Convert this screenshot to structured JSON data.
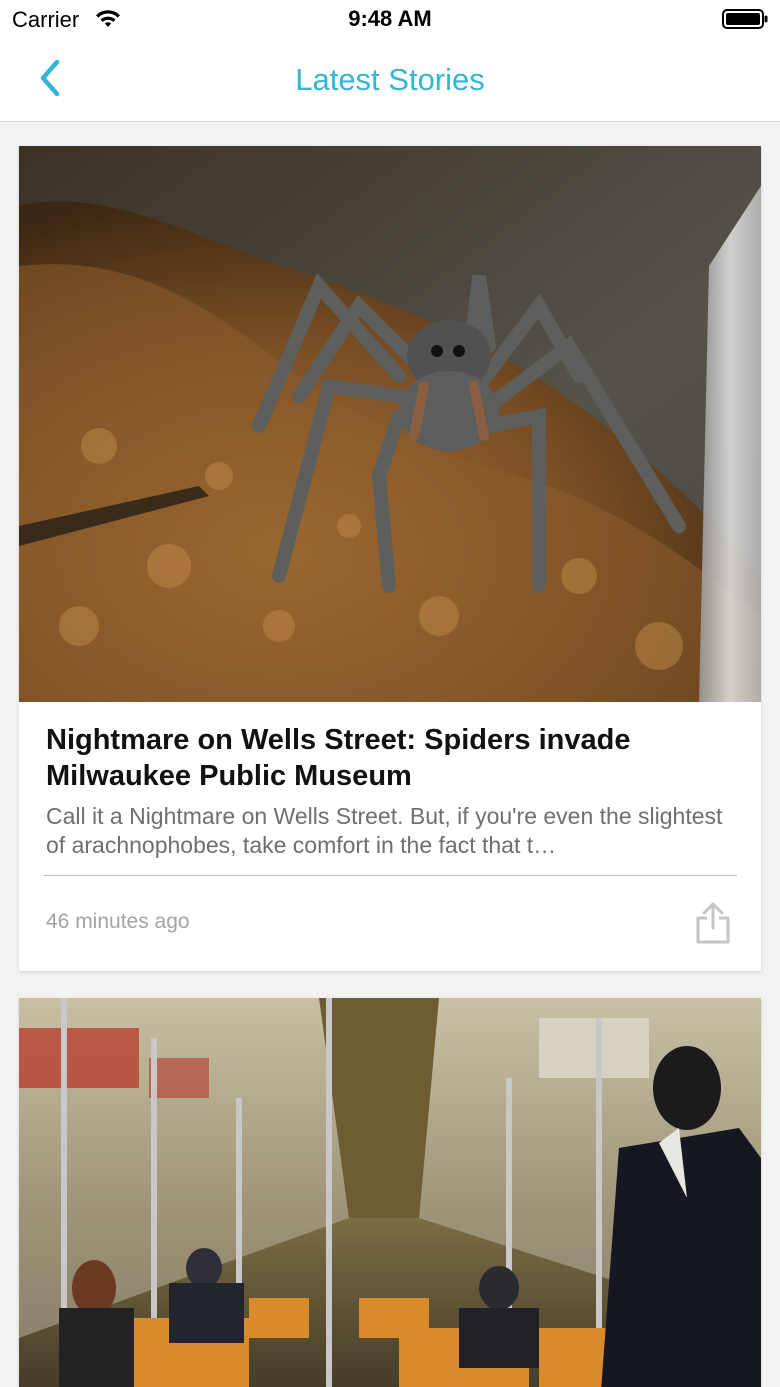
{
  "status_bar": {
    "carrier": "Carrier",
    "time": "9:48 AM",
    "wifi_icon": "wifi-icon",
    "battery_icon": "battery-icon"
  },
  "nav": {
    "title": "Latest Stories",
    "back_icon": "chevron-left-icon"
  },
  "colors": {
    "accent": "#31b6d6",
    "title_text": "#111111",
    "summary_text": "#6f6f6f",
    "meta_text": "#a3a3a3",
    "background": "#f2f2f2"
  },
  "stories": [
    {
      "image": "spider-photo",
      "title": "Nightmare on Wells Street: Spiders invade Milwaukee Public Museum",
      "summary": "Call it a Nightmare on Wells Street. But, if you're even the slightest of arachnophobes, take comfort in the fact that t…",
      "time": "46 minutes ago",
      "share_icon": "share-icon"
    },
    {
      "image": "subway-car-photo"
    }
  ]
}
